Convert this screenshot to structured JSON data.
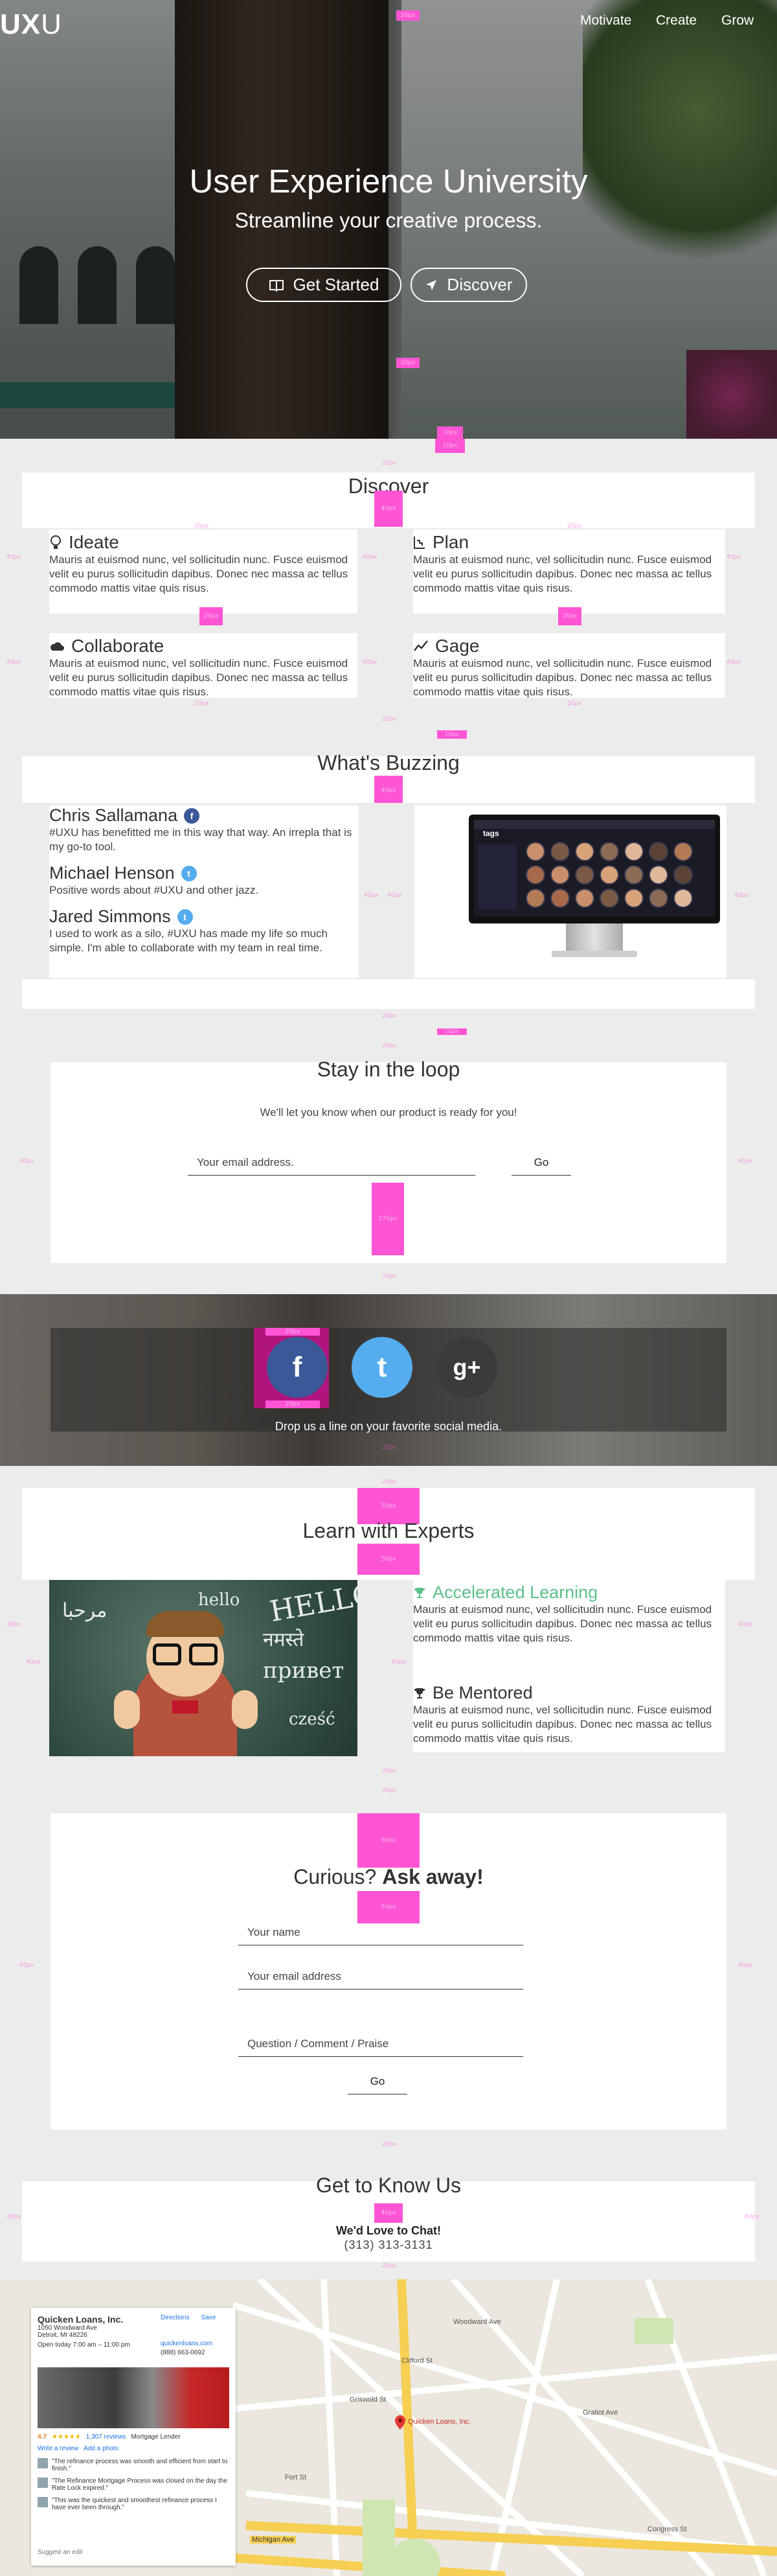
{
  "colors": {
    "accent": "#ff55d4",
    "facebook": "#3b5998",
    "twitter": "#55acee",
    "googleplus": "#3b3b3b",
    "green": "#5cc08a"
  },
  "header": {
    "logo_prefix": "UX",
    "logo_suffix": "U",
    "nav": [
      "Motivate",
      "Create",
      "Grow"
    ]
  },
  "hero": {
    "title": "User Experience University",
    "subtitle": "Streamline your creative process.",
    "buttons": [
      {
        "label": "Get Started",
        "icon": "book-icon"
      },
      {
        "label": "Discover",
        "icon": "send-icon"
      }
    ]
  },
  "discover": {
    "title": "Discover",
    "cards": [
      {
        "title": "Ideate",
        "icon": "lightbulb-icon",
        "text": "Mauris at euismod nunc, vel sollicitudin nunc. Fusce euismod velit eu purus sollicitudin dapibus. Donec nec massa ac tellus commodo mattis vitae quis risus."
      },
      {
        "title": "Plan",
        "icon": "steps-icon",
        "text": "Mauris at euismod nunc, vel sollicitudin nunc. Fusce euismod velit eu purus sollicitudin dapibus. Donec nec massa ac tellus commodo mattis vitae quis risus."
      },
      {
        "title": "Collaborate",
        "icon": "cloud-icon",
        "text": "Mauris at euismod nunc, vel sollicitudin nunc. Fusce euismod velit eu purus sollicitudin dapibus. Donec nec massa ac tellus commodo mattis vitae quis risus."
      },
      {
        "title": "Gage",
        "icon": "chart-icon",
        "text": "Mauris at euismod nunc, vel sollicitudin nunc. Fusce euismod velit eu purus sollicitudin dapibus. Donec nec massa ac tellus commodo mattis vitae quis risus."
      }
    ]
  },
  "buzzing": {
    "title": "What's Buzzing",
    "people": [
      {
        "name": "Chris Sallamana",
        "network": "facebook",
        "quote": "#UXU has benefitted me in this way that way. An irrepla that is my go-to tool."
      },
      {
        "name": "Michael Henson",
        "network": "twitter",
        "quote": "Positive words about #UXU and other jazz."
      },
      {
        "name": "Jared Simmons",
        "network": "twitter",
        "quote": "I used to work as a silo, #UXU has made my life so much simple. I'm able to collaborate with my team in real time."
      }
    ],
    "monitor_brand": "tags"
  },
  "loop": {
    "title": "Stay in the loop",
    "subtitle": "We'll let you know when our product is ready for you!",
    "email_placeholder": "Your email address.",
    "button": "Go"
  },
  "social": {
    "caption": "Drop us a line on your favorite social media.",
    "icons": [
      {
        "name": "facebook-icon",
        "glyph": "f"
      },
      {
        "name": "twitter-icon",
        "glyph": "t"
      },
      {
        "name": "googleplus-icon",
        "glyph": "g+"
      }
    ]
  },
  "experts": {
    "title": "Learn with Experts",
    "items": [
      {
        "title": "Accelerated Learning",
        "icon": "trophy-icon",
        "text": "Mauris at euismod nunc, vel sollicitudin nunc. Fusce euismod velit eu purus sollicitudin dapibus. Donec nec massa ac tellus commodo mattis vitae quis risus."
      },
      {
        "title": "Be Mentored",
        "icon": "trophy-icon",
        "text": "Mauris at euismod nunc, vel sollicitudin nunc. Fusce euismod velit eu purus sollicitudin dapibus. Donec nec massa ac tellus commodo mattis vitae quis risus."
      }
    ],
    "chalk_words": [
      "HELLO",
      "привет",
      "नमस्ते",
      "cześć",
      "hello",
      "مرحبا"
    ]
  },
  "curious": {
    "title_light": "Curious?",
    "title_bold": "Ask away!",
    "name_placeholder": "Your name",
    "email_placeholder": "Your email address",
    "comment_placeholder": "Question / Comment / Praise",
    "button": "Go"
  },
  "know": {
    "title": "Get to Know Us",
    "chat": "We'd Love to Chat!",
    "phone": "(313) 313-3131"
  },
  "map": {
    "business": "Quicken Loans, Inc.",
    "address1": "1050 Woodward Ave",
    "address2": "Detroit, MI 48226",
    "hours": "Open today  7:00 am – 11:00 pm",
    "website": "quickenloans.com",
    "phone": "(888) 663-0692",
    "rating": "4.7",
    "reviews": "1,307 reviews",
    "category": "Mortgage Lender",
    "write_review": "Write a review",
    "add_photo": "Add a photo",
    "review1": "\"The refinance process was smooth and efficient from start to finish.\"",
    "review2": "\"The Refinance Mortgage Process was closed on the day the Rate Lock expired.\"",
    "review3": "\"This was the quickest and smoothest refinance process I have ever been through.\"",
    "suggest": "Suggest an edit",
    "directions": "Directions",
    "save": "Save",
    "pin_label": "Quicken Loans, Inc.",
    "streets": [
      "Michigan Ave",
      "Woodward Ave",
      "Griswold St",
      "Gratiot Ave",
      "Congress St",
      "Fort St",
      "Clifford St"
    ]
  },
  "spacing_labels": {
    "s20": "20px",
    "s40": "40px",
    "s50": "50px",
    "s10": "10px",
    "s150": "150px",
    "s175": "175px",
    "s60": "60px",
    "s200": "200px"
  }
}
